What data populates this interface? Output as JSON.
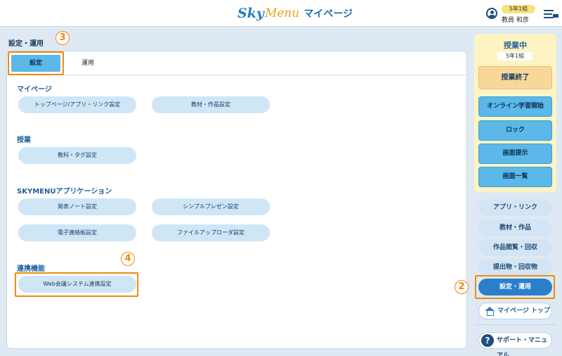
{
  "header": {
    "logo_sky": "Sky",
    "logo_menu": "Menu",
    "title": "マイページ",
    "user_class": "5年1組",
    "user_name": "教員 和彦"
  },
  "page": {
    "title": "設定・運用"
  },
  "tabs": {
    "settings": "設定",
    "operation": "運用"
  },
  "sections": {
    "mypage": {
      "title": "マイページ",
      "buttons": [
        "トップページ/アプリ・リンク設定",
        "教材・作品設定"
      ]
    },
    "class": {
      "title": "授業",
      "buttons": [
        "教科・タグ設定"
      ]
    },
    "apps": {
      "title": "SKYMENUアプリケーション",
      "buttons": [
        "発表ノート設定",
        "シンプルプレゼン設定",
        "電子連絡板設定",
        "ファイルアップローダ設定"
      ]
    },
    "integration": {
      "title": "連携機能",
      "buttons": [
        "Web会議システム連携設定"
      ]
    }
  },
  "sidebar": {
    "status": "授業中",
    "class": "5年1組",
    "end_class": "授業終了",
    "actions": [
      "オンライン学習開始",
      "ロック",
      "画面提示",
      "画面一覧"
    ],
    "links": [
      "アプリ・リンク",
      "教材・作品",
      "作品閲覧・回収",
      "提出物・回収物",
      "設定・運用"
    ],
    "mypage_top": "マイページ トップ",
    "support": "サポート・マニュアル"
  },
  "callouts": {
    "n2": "2",
    "n3": "3",
    "n4": "4"
  },
  "colors": {
    "accent": "#5bb8e8",
    "highlight": "#f08a0c",
    "active": "#2b7fc9",
    "in_class_bg": "#fcf4c2"
  }
}
